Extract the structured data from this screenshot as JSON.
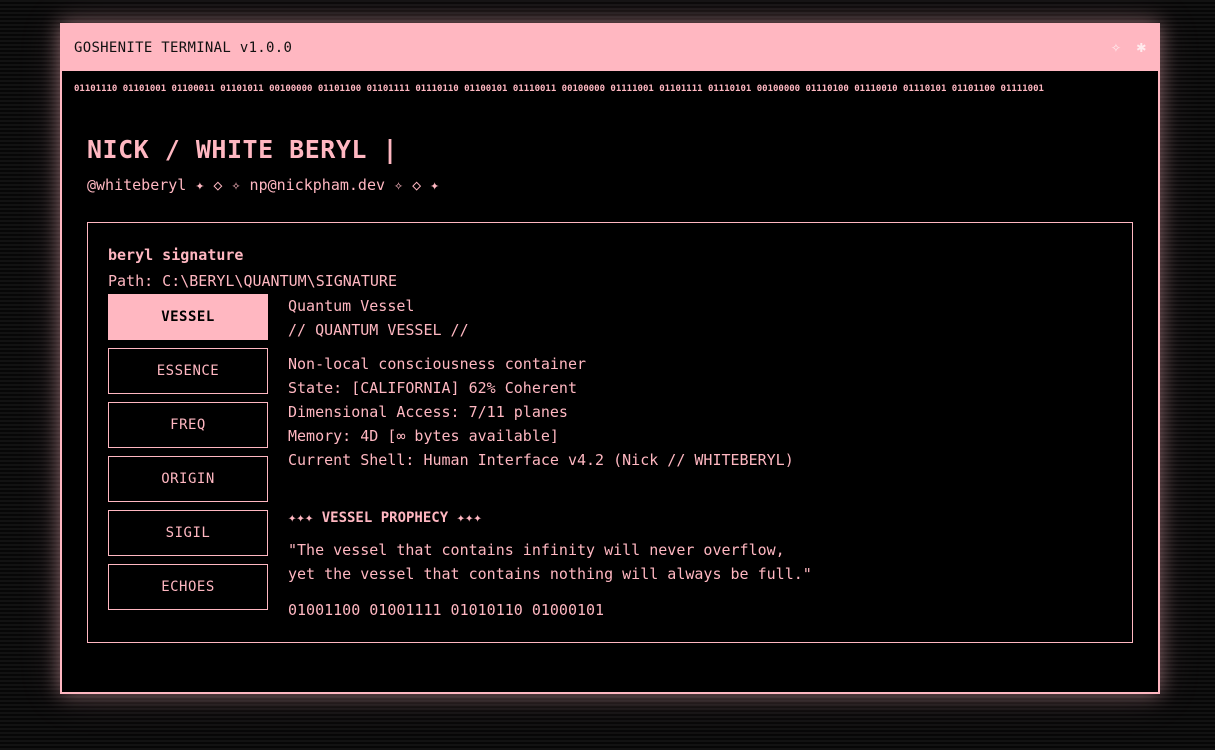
{
  "window": {
    "title": "GOSHENITE TERMINAL v1.0.0",
    "controls": [
      "✧",
      "✱"
    ]
  },
  "binary_strip": "01101110 01101001 01100011 01101011 00100000 01101100 01101111 01110110 01100101 01110011 00100000 01111001 01101111 01110101 00100000 01110100 01110010 01110101 01101100 01111001",
  "header": {
    "name": "NICK / WHITE BERYL |",
    "handle": "@whiteberyl ✦ ◇ ✧ np@nickpham.dev ✧ ◇ ✦"
  },
  "panel": {
    "title": "beryl signature",
    "path": "Path: C:\\BERYL\\QUANTUM\\SIGNATURE",
    "tabs": [
      {
        "label": "VESSEL",
        "active": true
      },
      {
        "label": "ESSENCE",
        "active": false
      },
      {
        "label": "FREQ",
        "active": false
      },
      {
        "label": "ORIGIN",
        "active": false
      },
      {
        "label": "SIGIL",
        "active": false
      },
      {
        "label": "ECHOES",
        "active": false
      }
    ],
    "content": {
      "name": "Quantum Vessel",
      "header": "// QUANTUM VESSEL //",
      "details": [
        "Non-local consciousness container",
        "State: [CALIFORNIA] 62% Coherent",
        "Dimensional Access: 7/11 planes",
        "Memory: 4D [∞ bytes available]",
        "Current Shell: Human Interface v4.2 (Nick // WHITEBERYL)"
      ],
      "prophecy_title": "✦✦✦ VESSEL PROPHECY ✦✦✦",
      "prophecy_lines": [
        "\"The vessel that contains infinity will never overflow,",
        "yet the vessel that contains nothing will always be full.\""
      ],
      "binary": "01001100 01001111 01010110 01000101"
    }
  }
}
